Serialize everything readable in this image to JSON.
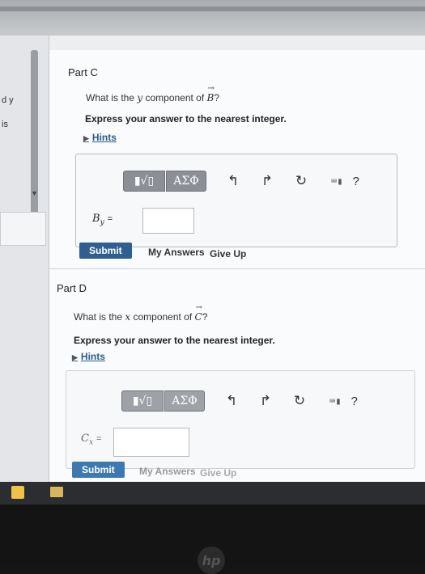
{
  "sidebar": {
    "text1": "d y",
    "text2": "is"
  },
  "partC": {
    "title": "Part C",
    "question_prefix": "What is the ",
    "question_var": "y",
    "question_mid": " component of ",
    "question_vector": "B",
    "question_suffix": "?",
    "instruction": "Express your answer to the nearest integer.",
    "hints": "Hints",
    "toolbar": {
      "math_label": "▮√▯",
      "greek_label": "ΑΣΦ",
      "undo": "↰",
      "redo": "↱",
      "reset": "↻",
      "keyboard": "⌨▮",
      "help": "?"
    },
    "var_symbol": "B",
    "var_sub": "y",
    "var_eq": "=",
    "submit": "Submit",
    "my_answers": "My Answers",
    "give_up": "Give Up"
  },
  "partD": {
    "title": "Part D",
    "question_prefix": "What is the ",
    "question_var": "x",
    "question_mid": " component of ",
    "question_vector": "C",
    "question_suffix": "?",
    "instruction": "Express your answer to the nearest integer.",
    "hints": "Hints",
    "toolbar": {
      "math_label": "▮√▯",
      "greek_label": "ΑΣΦ",
      "undo": "↰",
      "redo": "↱",
      "reset": "↻",
      "keyboard": "⌨▮",
      "help": "?"
    },
    "var_symbol": "C",
    "var_sub": "x",
    "var_eq": "=",
    "submit": "Submit",
    "my_answers": "My Answers",
    "give_up": "Give Up"
  },
  "colors": {
    "submit_bg": "#2f5f91",
    "hint_link": "#2c5a8c",
    "toolbar_btn": "#8c9096"
  }
}
